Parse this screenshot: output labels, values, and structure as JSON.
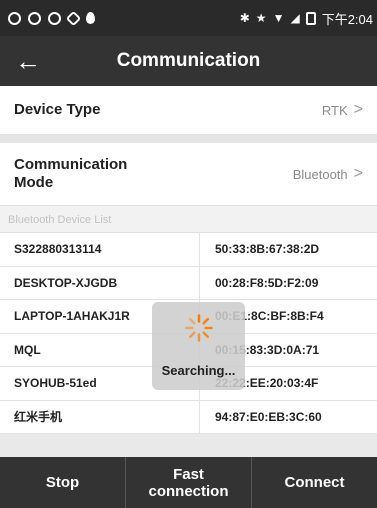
{
  "status_bar": {
    "time": "下午2:04",
    "left_icons": [
      "notification-icon",
      "notification-icon",
      "settings-icon",
      "notification-icon",
      "location-icon"
    ],
    "right_icons": [
      "bluetooth-icon",
      "star-icon",
      "wifi-icon",
      "signal-icon",
      "battery-icon"
    ]
  },
  "toolbar": {
    "title": "Communication",
    "back_icon": "arrow-left-icon",
    "back_glyph": "←"
  },
  "settings": {
    "device_type": {
      "label": "Device Type",
      "value": "RTK"
    },
    "communication_mode": {
      "label_line1": "Communication",
      "label_line2": "Mode",
      "value": "Bluetooth"
    },
    "chevron": ">"
  },
  "list_header": "Bluetooth Device List",
  "devices": [
    {
      "name": "S322880313114",
      "mac": "50:33:8B:67:38:2D"
    },
    {
      "name": "DESKTOP-XJGDB",
      "mac": "00:28:F8:5D:F2:09"
    },
    {
      "name": "LAPTOP-1AHAKJ1R",
      "mac": "00:E1:8C:BF:8B:F4"
    },
    {
      "name": "MQL",
      "mac": "00:15:83:3D:0A:71"
    },
    {
      "name": "SYOHUB-51ed",
      "mac": "22:22:EE:20:03:4F"
    },
    {
      "name": "红米手机",
      "mac": "94:87:E0:EB:3C:60"
    }
  ],
  "loading": {
    "text": "Searching...",
    "icon": "spinner-icon",
    "accent_color": "#f57c00"
  },
  "bottom_bar": {
    "stop": "Stop",
    "fast_connection_line1": "Fast",
    "fast_connection_line2": "connection",
    "connect": "Connect"
  }
}
